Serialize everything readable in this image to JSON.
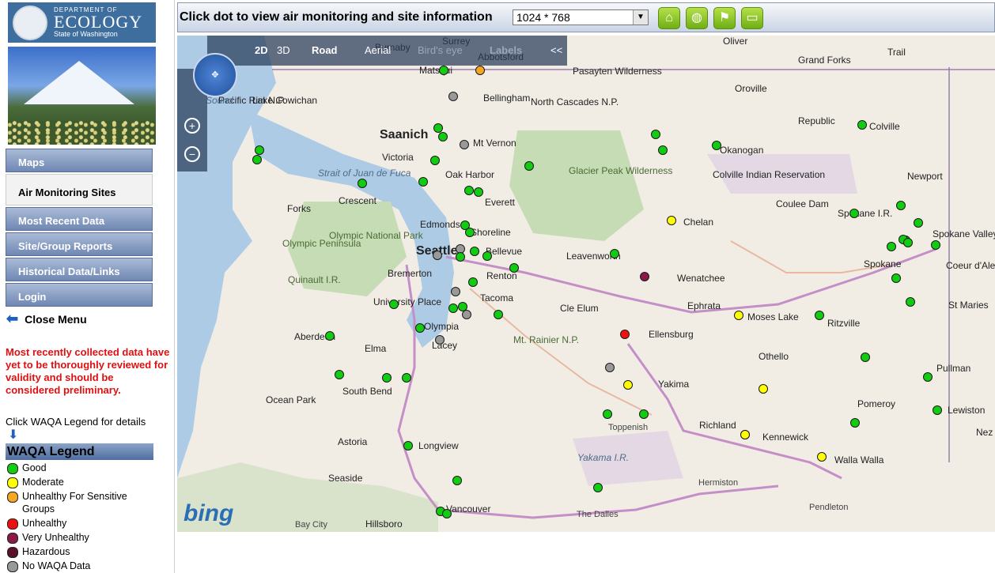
{
  "logo": {
    "line1": "DEPARTMENT OF",
    "line2": "ECOLOGY",
    "line3": "State of Washington"
  },
  "nav": [
    "Maps",
    "Air Monitoring Sites",
    "Most Recent Data",
    "Site/Group Reports",
    "Historical Data/Links",
    "Login"
  ],
  "close_menu": "Close Menu",
  "disclaimer": "Most recently collected data have yet to be thoroughly reviewed for validity and should be considered preliminary.",
  "legend_hint": "Click WAQA Legend for details",
  "legend": {
    "title": "WAQA Legend",
    "items": [
      {
        "label": "Good",
        "color": "#11cc11"
      },
      {
        "label": "Moderate",
        "color": "#ffff00"
      },
      {
        "label": "Unhealthy For Sensitive Groups",
        "color": "#f5a623"
      },
      {
        "label": "Unhealthy",
        "color": "#ee1111"
      },
      {
        "label": "Very Unhealthy",
        "color": "#8a1a4a"
      },
      {
        "label": "Hazardous",
        "color": "#5a0f2a"
      },
      {
        "label": "No WAQA Data",
        "color": "#999999"
      }
    ]
  },
  "toolbar": {
    "message": "Click dot to view air monitoring and site information",
    "resolution": "1024 * 768"
  },
  "map_toolbar": {
    "mode2d": "2D",
    "mode3d": "3D",
    "road": "Road",
    "aerial": "Aerial",
    "birds_eye": "Bird's eye",
    "labels": "Labels",
    "collapse": "<<"
  },
  "map_attribution": "bing",
  "places": [
    "Burnaby",
    "Surrey",
    "Abbotsford",
    "Oliver",
    "Grand Forks",
    "Trail",
    "Pasayten Wilderness",
    "Matsqui",
    "Bellingham",
    "Oroville",
    "North Cascades N.P.",
    "Republic",
    "Colville",
    "Pacific Rim N.P.",
    "Lake Cowichan",
    "Saanich",
    "Mt Vernon",
    "Victoria",
    "Okanogan",
    "Strait of Juan de Fuca",
    "Oak Harbor",
    "Glacier Peak Wilderness",
    "Colville Indian Reservation",
    "Newport",
    "Forks",
    "Crescent",
    "Everett",
    "Coulee Dam",
    "Spokane I.R.",
    "Edmonds",
    "Shoreline",
    "Chelan",
    "Olympic Peninsula",
    "Olympic National Park",
    "Seattle",
    "Bellevue",
    "Leavenworth",
    "Spokane",
    "Spokane Valley",
    "Quinault I.R.",
    "Bremerton",
    "Renton",
    "Wenatchee",
    "Coeur d'Alene I.R.",
    "University Place",
    "Tacoma",
    "Cle Elum",
    "Ephrata",
    "Moses Lake",
    "Ritzville",
    "St Maries",
    "Olympia",
    "Lacey",
    "Ellensburg",
    "Aberdeen",
    "Elma",
    "Mt. Rainier N.P.",
    "Othello",
    "South Bend",
    "Yakima",
    "Pullman",
    "Ocean Park",
    "Pomeroy",
    "Lewiston",
    "Toppenish",
    "Richland",
    "Kennewick",
    "Nez Perce",
    "Astoria",
    "Longview",
    "Yakama I.R.",
    "Walla Walla",
    "Seaside",
    "Hermiston",
    "Vancouver",
    "The Dalles",
    "Pendleton",
    "Bay City",
    "Hillsboro",
    "Sound"
  ],
  "stations": [
    "good",
    "ususg",
    "none",
    "good",
    "good",
    "none",
    "good",
    "good",
    "good",
    "good",
    "good",
    "good",
    "moderate",
    "good",
    "good",
    "good",
    "good",
    "good",
    "good",
    "good",
    "none",
    "good",
    "good",
    "none",
    "good",
    "good",
    "very",
    "good",
    "good",
    "good",
    "none",
    "good",
    "good",
    "good",
    "good",
    "none",
    "none",
    "good",
    "good",
    "good",
    "good",
    "good",
    "moderate",
    "unhealthy",
    "moderate",
    "none",
    "good",
    "good",
    "moderate",
    "good",
    "good",
    "moderate",
    "good",
    "good",
    "good",
    "good",
    "moderate",
    "good",
    "good",
    "good",
    "good",
    "good",
    "good",
    "good",
    "good",
    "good",
    "good",
    "good",
    "good",
    "good",
    "good",
    "good",
    "good",
    "good",
    "good",
    "good",
    "good",
    "good",
    "good"
  ]
}
